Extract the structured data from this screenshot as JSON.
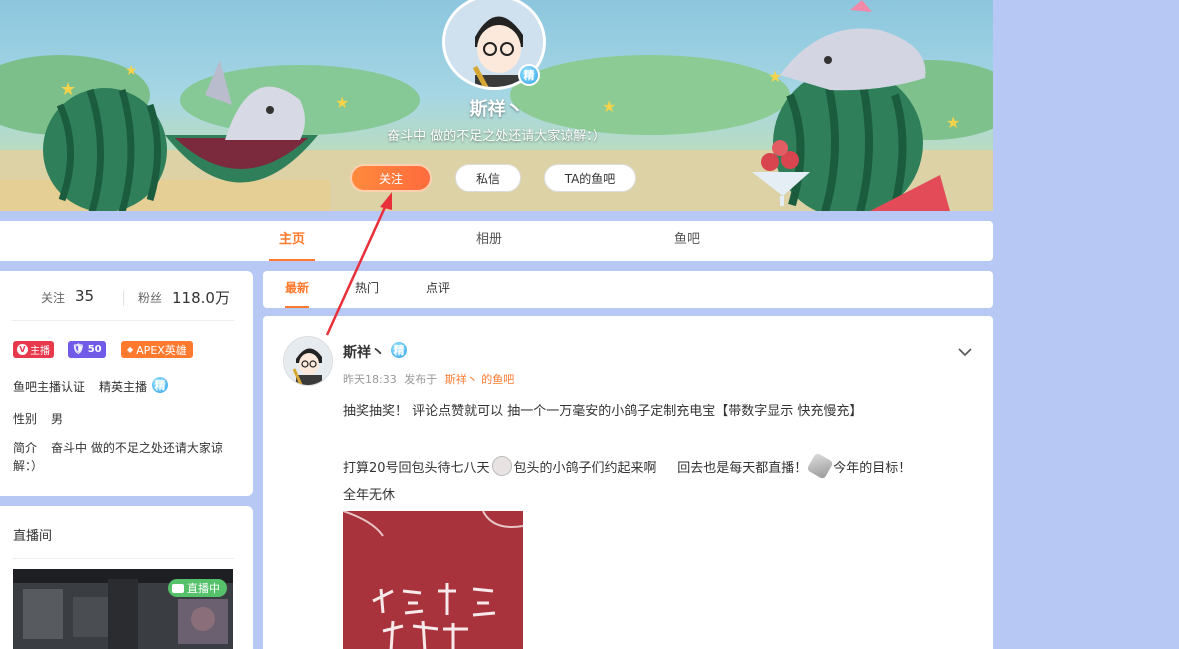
{
  "profile": {
    "name": "斯祥丶",
    "badge": "精",
    "motto": "奋斗中 做的不足之处还请大家谅解：）",
    "buttons": {
      "follow": "关注",
      "message": "私信",
      "fishbar": "TA的鱼吧"
    }
  },
  "main_tabs": [
    "主页",
    "相册",
    "鱼吧"
  ],
  "stats": {
    "following_label": "关注",
    "following": "35",
    "fans_label": "粉丝",
    "fans": "118.0万"
  },
  "tags": {
    "anchor": "主播",
    "level": "50",
    "game": "APEX英雄"
  },
  "info": {
    "cert_label": "鱼吧主播认证",
    "cert_value": "精英主播",
    "gender_label": "性别",
    "gender_value": "男",
    "intro_label": "简介",
    "intro_value": "奋斗中 做的不足之处还请大家谅解：）"
  },
  "live": {
    "title": "直播间",
    "status": "直播中"
  },
  "feed_tabs": [
    "最新",
    "热门",
    "点评"
  ],
  "post": {
    "author": "斯祥丶",
    "badge": "精",
    "time": "昨天18:33",
    "posted_in": "发布于",
    "bar_link": "斯祥丶 的鱼吧",
    "line1": "抽奖抽奖！  评论点赞就可以  抽一个一万毫安的小鸽子定制充电宝【带数字显示 快充慢充】",
    "line2a": "打算20号回包头待七八天",
    "line2b": "包头的小鸽子们约起来啊     回去也是每天都直播！",
    "line2c": "今年的目标！",
    "line3": "全年无休"
  },
  "colors": {
    "accent": "#ff7a2f",
    "page_bg": "#b8c8f4",
    "live_green": "#55c26b",
    "badge_blue": "#2ea1e8"
  }
}
